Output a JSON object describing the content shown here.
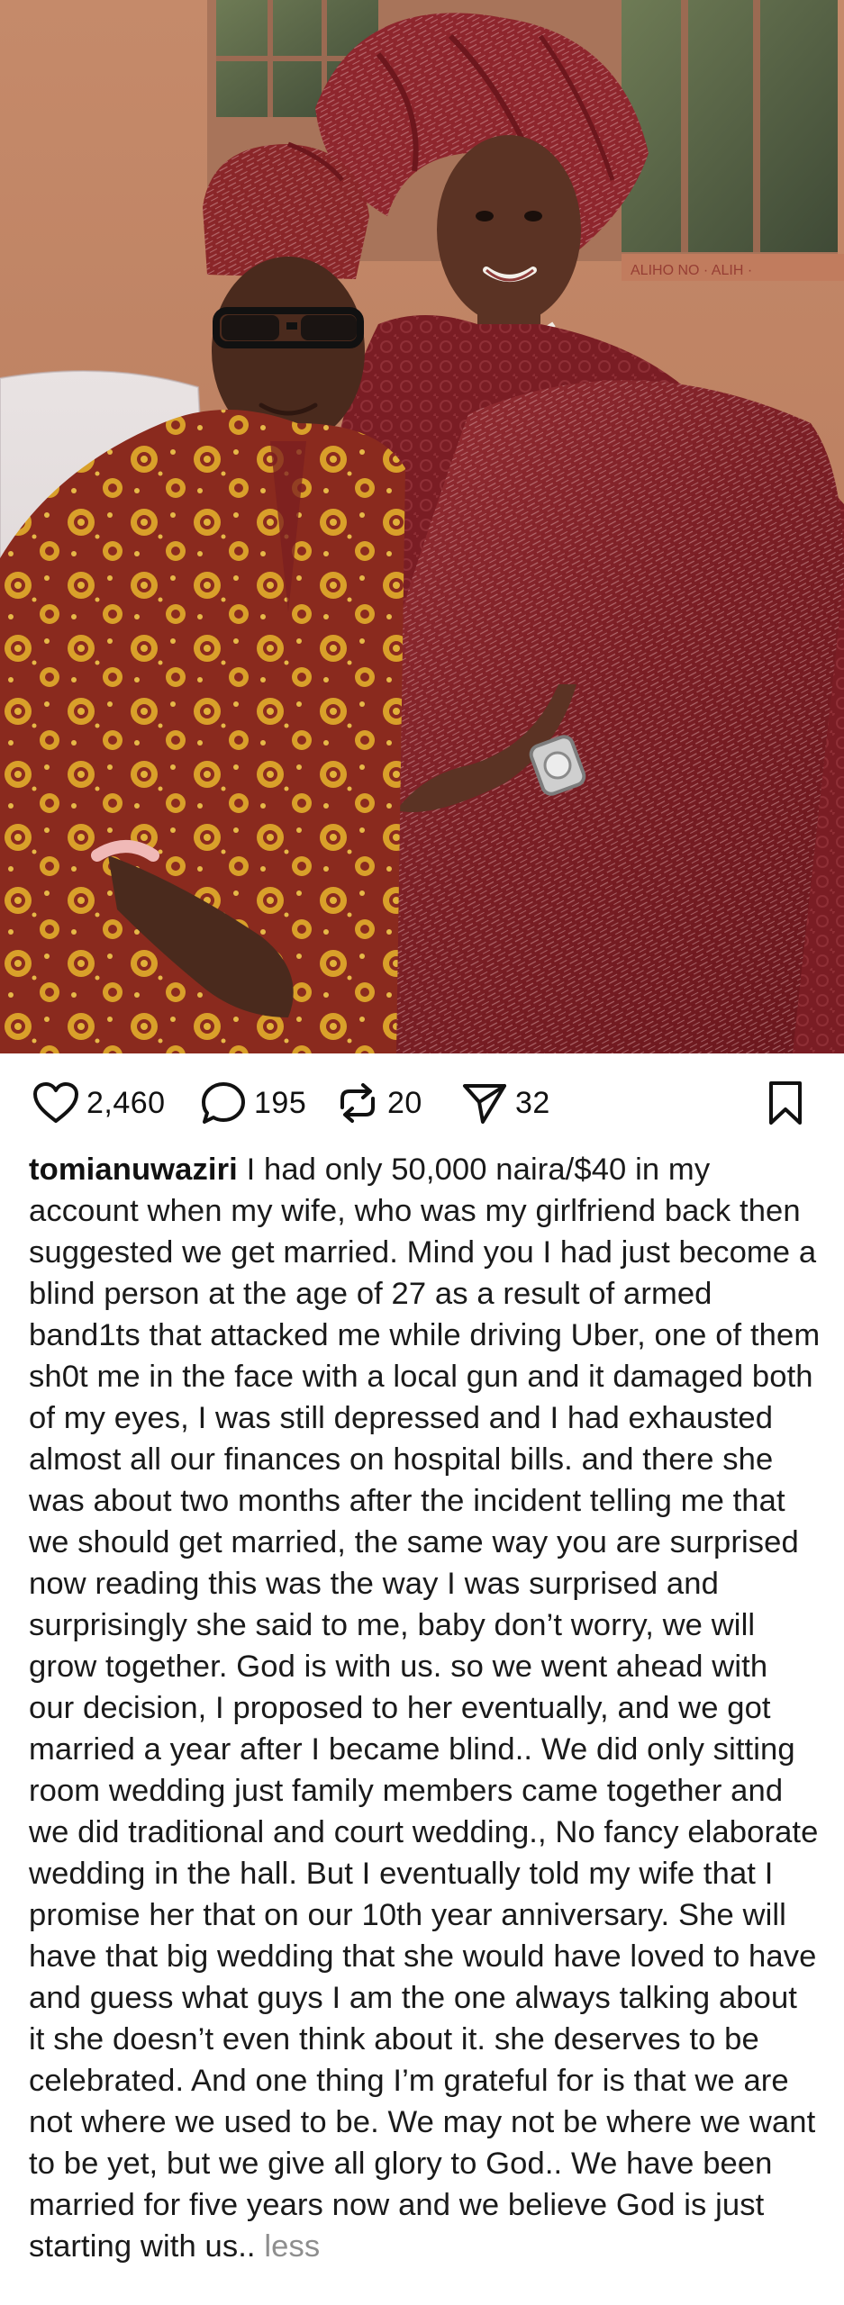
{
  "post": {
    "image_alt": "Couple in matching burgundy traditional attire seated together"
  },
  "actions": {
    "like_count": "2,460",
    "comment_count": "195",
    "repost_count": "20",
    "share_count": "32"
  },
  "caption": {
    "username": "tomianuwaziri",
    "text": "I had only 50,000 naira/$40 in my account when my wife, who was my girlfriend back then suggested we get married. Mind you I had just become a blind person at the age of 27 as a result of armed band1ts that attacked me while driving Uber, one of them sh0t me in the face with a local gun and it damaged both of my eyes, I was still depressed and I had exhausted almost all our finances on hospital bills. and there she was about two months after the incident telling me that we should get married, the same way you are surprised now reading this was the way I was surprised and surprisingly she said to me, baby don’t worry, we will grow together. God is with us. so we went ahead with our decision, I proposed to her eventually, and we got married a year after I became blind.. We did only sitting room wedding just family members came together and we did traditional and court wedding., No fancy elaborate wedding in the hall. But I eventually told my wife that I promise her that on our 10th year anniversary. She will have that big wedding that she would have loved to have and guess what guys I am the one always talking about it she doesn’t even think about it. she deserves to be celebrated. And one thing I’m grateful for is that we are not where we used to be. We may not be where we want to be yet, but we give all glory to God.. We have been married for five years now and we believe God is just starting with us..",
    "more_label": "less"
  },
  "colors": {
    "text": "#111111",
    "muted": "#8e8e8e",
    "burgundy": "#7e1f23"
  }
}
